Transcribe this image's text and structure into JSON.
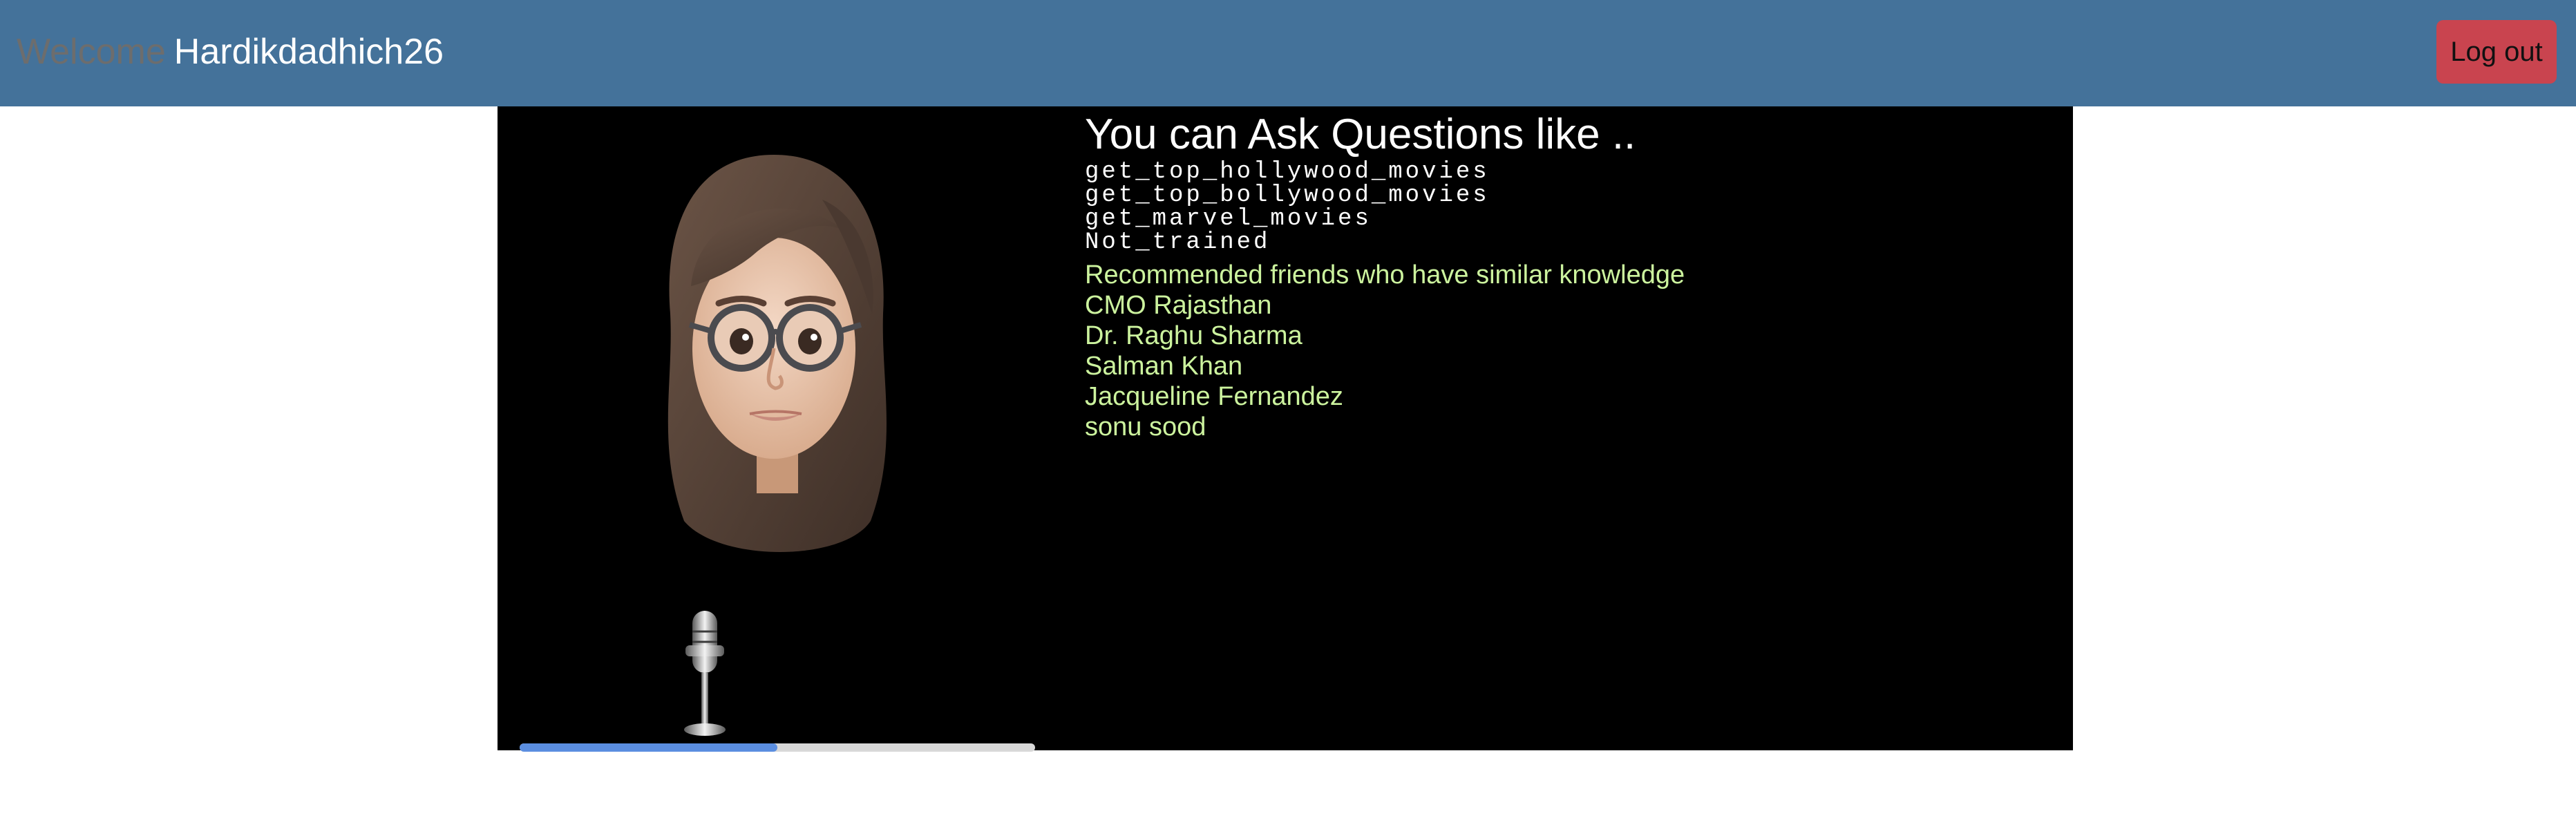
{
  "header": {
    "welcome_label": "Welcome",
    "username": "Hardikdadhich26",
    "logout_label": "Log out"
  },
  "questions": {
    "title": "You can Ask Questions like ..",
    "items": [
      "get_top_hollywood_movies",
      "get_top_bollywood_movies",
      "get_marvel_movies",
      "Not_trained"
    ]
  },
  "friends": {
    "heading": "Recommended friends who have similar knowledge",
    "items": [
      "CMO Rajasthan",
      "Dr. Raghu Sharma",
      "Salman Khan",
      "Jacqueline Fernandez",
      "sonu sood"
    ]
  },
  "audio": {
    "progress": 0.5
  },
  "icons": {
    "avatar": "memoji-avatar-icon",
    "microphone": "microphone-icon"
  },
  "colors": {
    "navbar": "#44729a",
    "logout_button": "#c9444f",
    "friends_text": "#ccf39e",
    "progress_fill": "#5b8ee0"
  }
}
